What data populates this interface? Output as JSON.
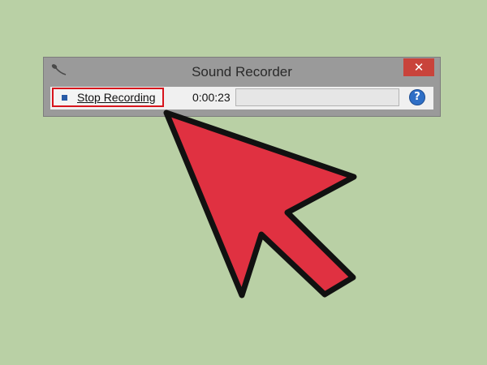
{
  "window": {
    "title": "Sound Recorder",
    "app_icon": "microphone-icon",
    "close_icon": "close-icon",
    "close_glyph": "✕"
  },
  "toolbar": {
    "stop_icon": "stop-icon",
    "stop_label_access_key": "S",
    "stop_label_rest": "top Recording",
    "elapsed_time": "0:00:23",
    "level_meter": 0,
    "help_icon": "help-icon",
    "help_glyph": "?"
  },
  "annotation": {
    "highlight_color": "#d7141c",
    "arrow_color": "#e03141"
  }
}
